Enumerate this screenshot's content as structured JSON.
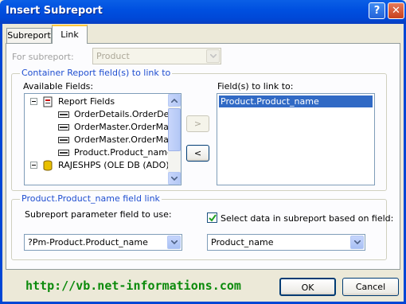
{
  "window": {
    "title": "Insert Subreport",
    "help_label": "?",
    "close_label": "✕"
  },
  "tabs": [
    {
      "label": "Subreport",
      "active": false
    },
    {
      "label": "Link",
      "active": true
    }
  ],
  "for_subreport": {
    "label": "For subreport:",
    "value": "Product",
    "enabled": false
  },
  "container_group": {
    "title": "Container Report field(s) to link to",
    "available_label": "Available Fields:",
    "tree": {
      "root_label": "Report Fields",
      "fields": [
        "OrderDetails.OrderDetai",
        "OrderMaster.OrderMast",
        "OrderMaster.OrderMast",
        "Product.Product_name"
      ],
      "db_label": "RAJESHPS (OLE DB (ADO))"
    },
    "add_button": ">",
    "remove_button": "<",
    "linked_label": "Field(s) to link to:",
    "linked_fields": [
      "Product.Product_name"
    ]
  },
  "field_link_group": {
    "title": "Product.Product_name field link",
    "param_label": "Subreport parameter field to use:",
    "param_value": "?Pm-Product.Product_name",
    "select_checkbox_label": "Select data in subreport based on field:",
    "select_checked": true,
    "select_field_value": "Product_name"
  },
  "footer": {
    "url": "http://vb.net-informations.com",
    "ok_label": "OK",
    "cancel_label": "Cancel"
  },
  "colors": {
    "accent": "#1f4ed0",
    "title_bar": "#0050e0",
    "selection": "#316ac5",
    "url_text": "#0b8a0b"
  }
}
